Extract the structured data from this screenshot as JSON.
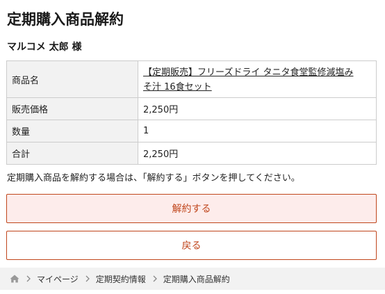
{
  "page": {
    "title": "定期購入商品解約",
    "customer_name": "マルコメ 太郎 様"
  },
  "details": {
    "product_label": "商品名",
    "product_name_line1": "【定期販売】フリーズドライ タニタ食堂監修減塩み",
    "product_name_line2": "そ汁 16食セット",
    "price_label": "販売価格",
    "price_value": "2,250円",
    "quantity_label": "数量",
    "quantity_value": "1",
    "total_label": "合計",
    "total_value": "2,250円"
  },
  "notice": "定期購入商品を解約する場合は、「解約する」ボタンを押してください。",
  "buttons": {
    "cancel_label": "解約する",
    "back_label": "戻る"
  },
  "breadcrumb": {
    "home_icon": "home-icon",
    "separator_icon": "chevron-right-icon",
    "items": [
      "マイページ",
      "定期契約情報",
      "定期購入商品解約"
    ]
  },
  "colors": {
    "accent": "#c0461c",
    "cancel_button_bg": "#fdeceb",
    "table_header_bg": "#f2f2f2",
    "breadcrumb_bg": "#f2f2f2"
  }
}
